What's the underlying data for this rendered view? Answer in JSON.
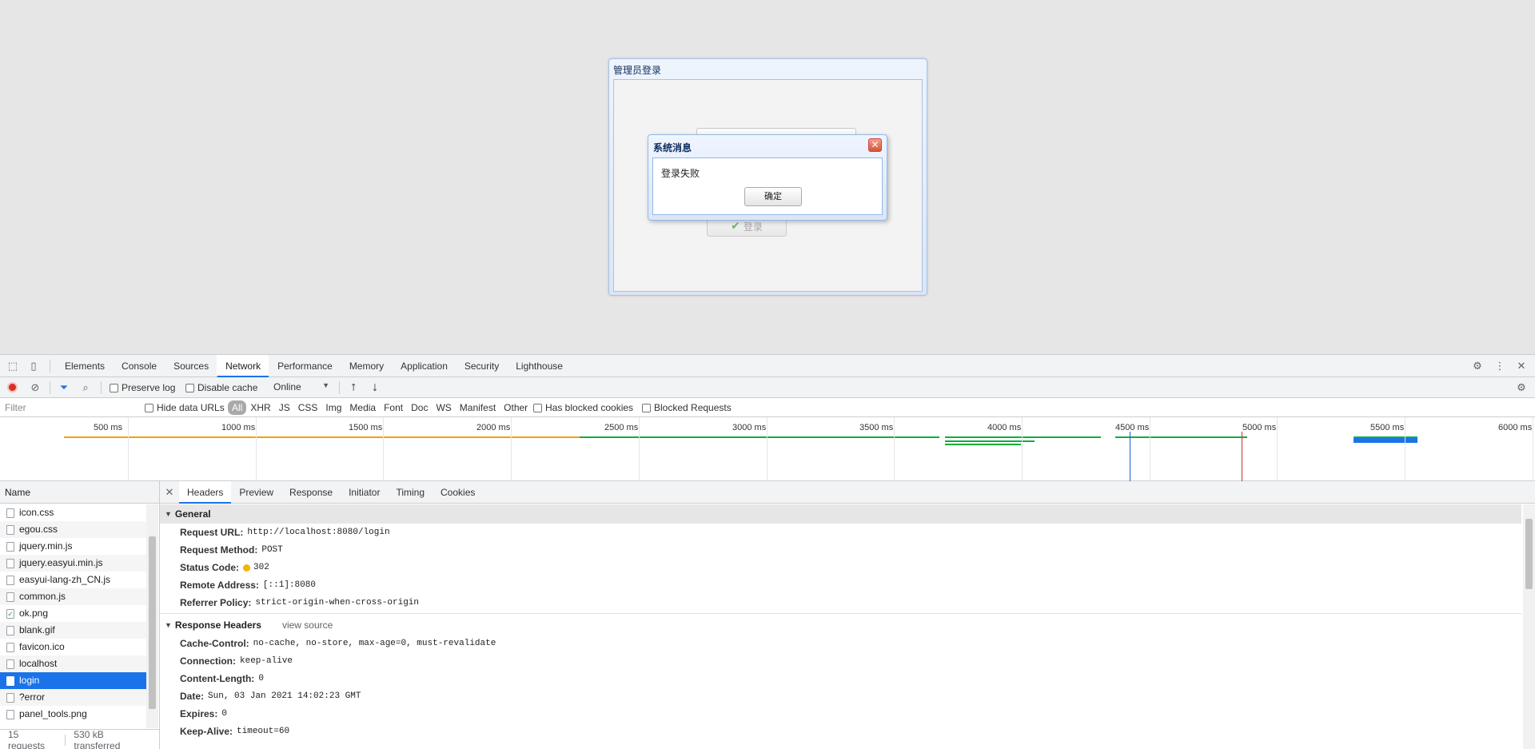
{
  "login_panel": {
    "title": "管理员登录",
    "login_button": "登录"
  },
  "message_window": {
    "title": "系统消息",
    "close": "✕",
    "text": "登录失败",
    "ok_label": "确定"
  },
  "devtools": {
    "tabs": [
      "Elements",
      "Console",
      "Sources",
      "Network",
      "Performance",
      "Memory",
      "Application",
      "Security",
      "Lighthouse"
    ],
    "active_tab": "Network",
    "toolbar": {
      "preserve_log": "Preserve log",
      "disable_cache": "Disable cache",
      "throttle": "Online"
    },
    "filter": {
      "placeholder": "Filter",
      "hide_data_urls": "Hide data URLs",
      "types": [
        "All",
        "XHR",
        "JS",
        "CSS",
        "Img",
        "Media",
        "Font",
        "Doc",
        "WS",
        "Manifest",
        "Other"
      ],
      "has_blocked_cookies": "Has blocked cookies",
      "blocked_requests": "Blocked Requests"
    },
    "timeline": {
      "ticks": [
        "500 ms",
        "1000 ms",
        "1500 ms",
        "2000 ms",
        "2500 ms",
        "3000 ms",
        "3500 ms",
        "4000 ms",
        "4500 ms",
        "5000 ms",
        "5500 ms",
        "6000 ms"
      ]
    },
    "request_list": {
      "header": "Name",
      "rows": [
        "icon.css",
        "egou.css",
        "jquery.min.js",
        "jquery.easyui.min.js",
        "easyui-lang-zh_CN.js",
        "common.js",
        "ok.png",
        "blank.gif",
        "favicon.ico",
        "localhost",
        "login",
        "?error",
        "panel_tools.png"
      ],
      "selected": "login",
      "footer_requests": "15 requests",
      "footer_transferred": "530 kB transferred"
    },
    "detail": {
      "tabs": [
        "Headers",
        "Preview",
        "Response",
        "Initiator",
        "Timing",
        "Cookies"
      ],
      "active_tab": "Headers",
      "general": {
        "title": "General",
        "request_url_k": "Request URL:",
        "request_url_v": "http://localhost:8080/login",
        "method_k": "Request Method:",
        "method_v": "POST",
        "status_k": "Status Code:",
        "status_v": "302",
        "remote_k": "Remote Address:",
        "remote_v": "[::1]:8080",
        "referrer_k": "Referrer Policy:",
        "referrer_v": "strict-origin-when-cross-origin"
      },
      "response_headers": {
        "title": "Response Headers",
        "view_source": "view source",
        "cache_k": "Cache-Control:",
        "cache_v": "no-cache, no-store, max-age=0, must-revalidate",
        "conn_k": "Connection:",
        "conn_v": "keep-alive",
        "len_k": "Content-Length:",
        "len_v": "0",
        "date_k": "Date:",
        "date_v": "Sun, 03 Jan 2021 14:02:23 GMT",
        "expires_k": "Expires:",
        "expires_v": "0",
        "keepalive_k": "Keep-Alive:",
        "keepalive_v": "timeout=60"
      }
    }
  },
  "colors": {
    "accent": "#1a73e8",
    "record": "#d93025",
    "status_warn": "#f2b400"
  },
  "icons": [
    "inspect-icon",
    "device-icon",
    "settings-icon",
    "more-icon",
    "close-icon",
    "record-icon",
    "clear-icon",
    "filter-icon",
    "search-icon",
    "upload-icon",
    "download-icon",
    "checkmark-icon"
  ]
}
